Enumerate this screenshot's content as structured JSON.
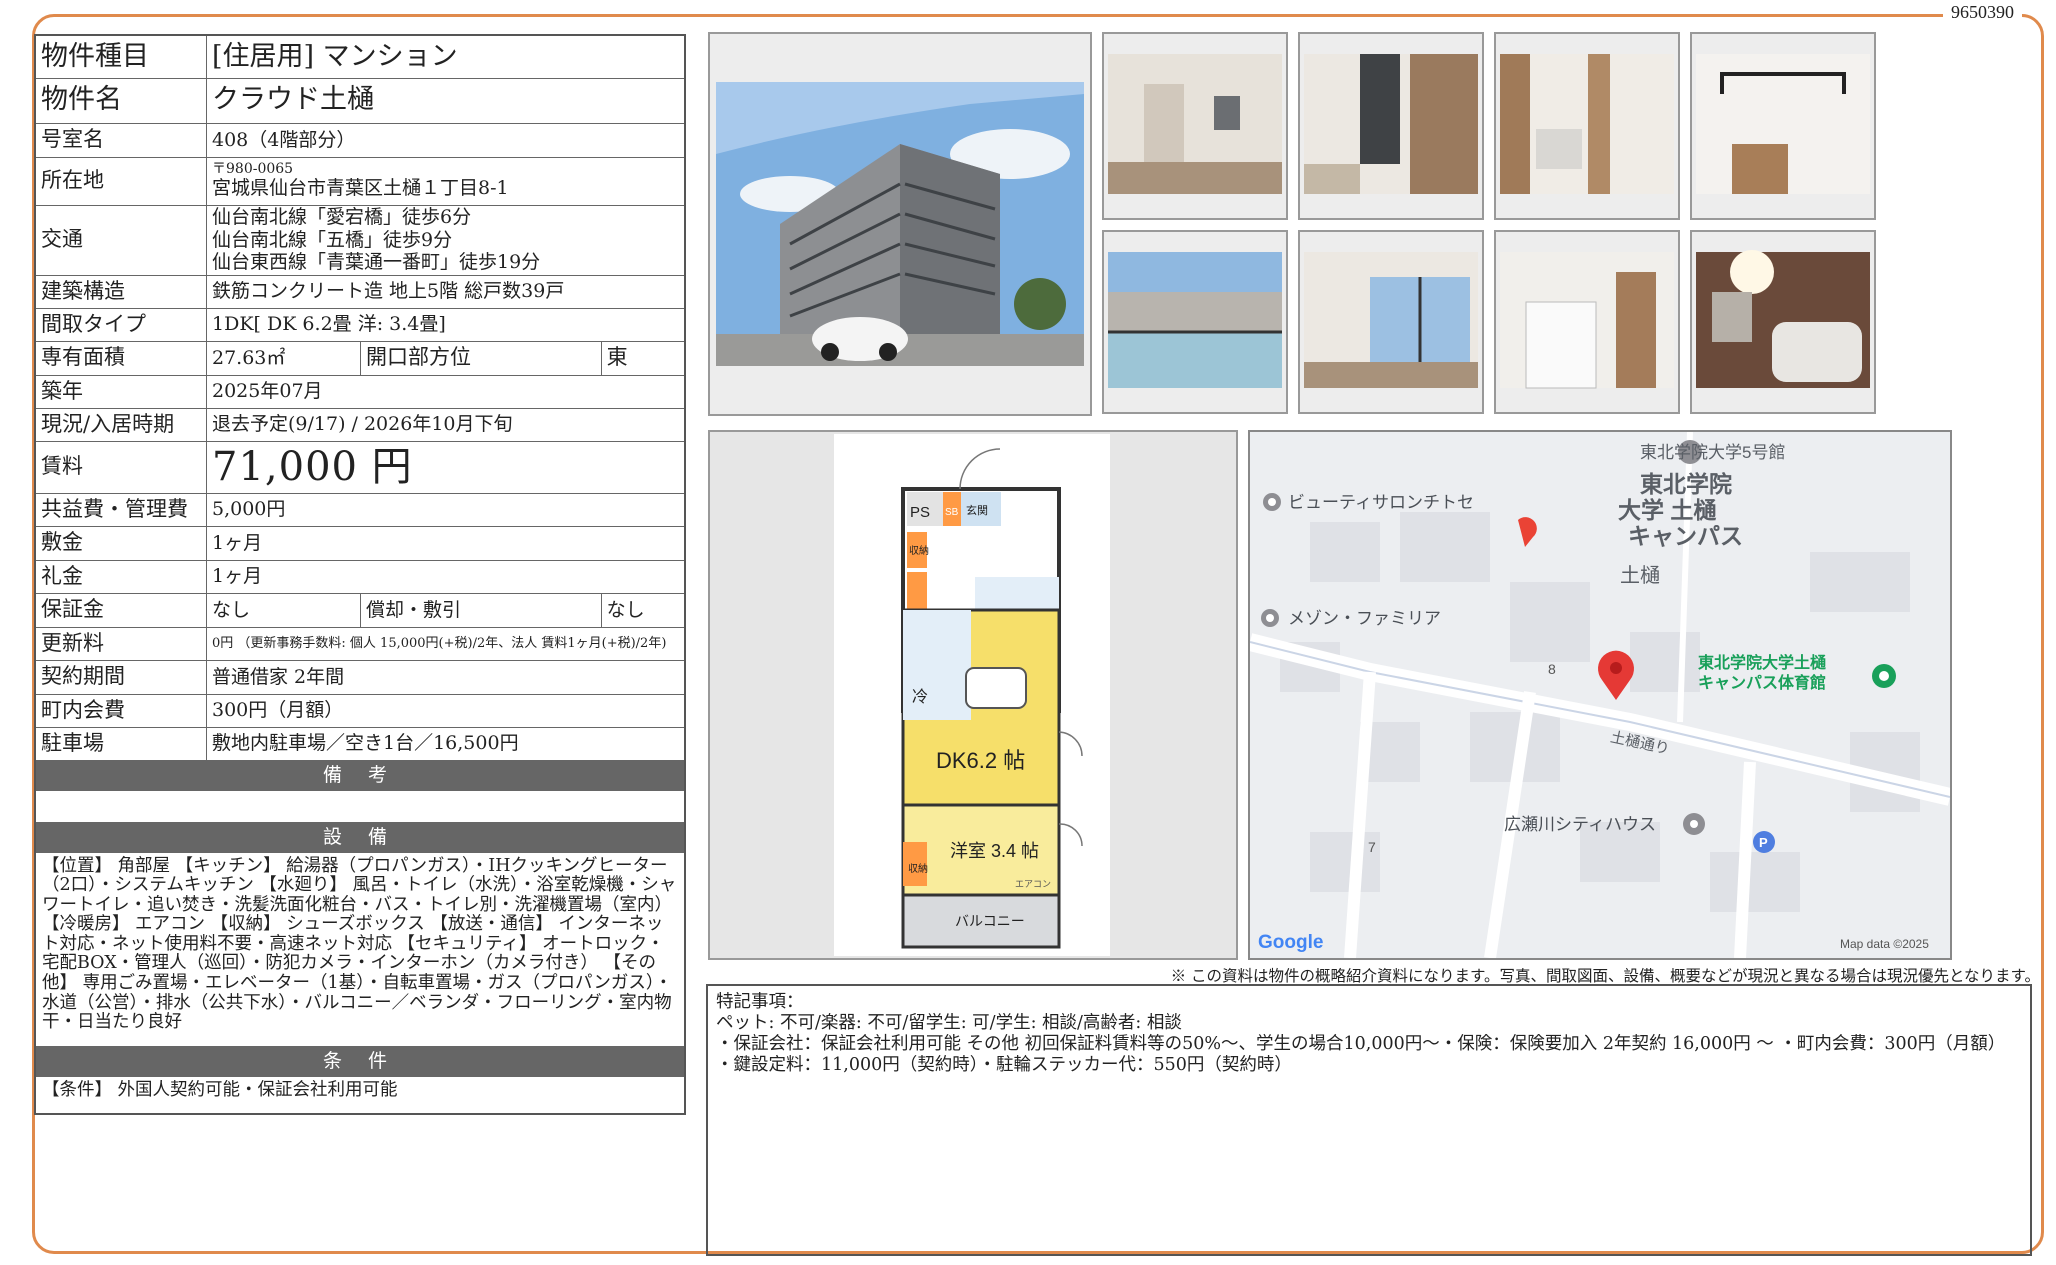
{
  "doc_id": "9650390",
  "property": {
    "type_label": "物件種目",
    "type_value": "[住居用] マンション",
    "name_label": "物件名",
    "name_value": "クラウド土樋",
    "room_label": "号室名",
    "room_value": "408（4階部分）",
    "address_label": "所在地",
    "address_zip": "〒980-0065",
    "address_value": "宮城県仙台市青葉区土樋１丁目8-1",
    "transit_label": "交通",
    "transit": [
      "仙台南北線「愛宕橋」徒歩6分",
      "仙台南北線「五橋」徒歩9分",
      "仙台東西線「青葉通一番町」徒歩19分"
    ],
    "structure_label": "建築構造",
    "structure_value": "鉄筋コンクリート造 地上5階 総戸数39戸",
    "layout_label": "間取タイプ",
    "layout_value": "1DK[ DK 6.2畳 洋: 3.4畳]",
    "area_label": "専有面積",
    "area_value": "27.63㎡",
    "direction_label": "開口部方位",
    "direction_value": "東",
    "built_label": "築年",
    "built_value": "2025年07月",
    "status_label": "現況/入居時期",
    "status_value": "退去予定(9/17) / 2026年10月下旬",
    "rent_label": "賃料",
    "rent_value": "71,000 円",
    "fee_label": "共益費・管理費",
    "fee_value": "5,000円",
    "deposit_label": "敷金",
    "deposit_value": "1ヶ月",
    "keymoney_label": "礼金",
    "keymoney_value": "1ヶ月",
    "guarantee_label": "保証金",
    "guarantee_value": "なし",
    "amort_label": "償却・敷引",
    "amort_value": "なし",
    "renewal_label": "更新料",
    "renewal_value": "0円 （更新事務手数料: 個人 15,000円(+税)/2年、法人 賃料1ヶ月(+税)/2年)",
    "contract_label": "契約期間",
    "contract_value": "普通借家 2年間",
    "community_label": "町内会費",
    "community_value": "300円（月額）",
    "parking_label": "駐車場",
    "parking_value": "敷地内駐車場／空き1台／16,500円"
  },
  "sections": {
    "remarks_title": "備 考",
    "remarks_body": "",
    "equipment_title": "設 備",
    "equipment_body": "【位置】 角部屋 【キッチン】 給湯器（プロパンガス）・IHクッキングヒーター（2口）・システムキッチン 【水廻り】 風呂・トイレ（水洗）・浴室乾燥機・シャワートイレ・追い焚き・洗髪洗面化粧台・バス・トイレ別・洗濯機置場（室内） 【冷暖房】 エアコン 【収納】 シューズボックス 【放送・通信】 インターネット対応・ネット使用料不要・高速ネット対応 【セキュリティ】 オートロック・宅配BOX・管理人（巡回）・防犯カメラ・インターホン（カメラ付き） 【その他】 専用ごみ置場・エレベーター（1基）・自転車置場・ガス（プロパンガス）・水道（公営）・排水（公共下水）・バルコニー／ベランダ・フローリング・室内物干・日当たり良好",
    "conditions_title": "条 件",
    "conditions_body": "【条件】 外国人契約可能・保証会社利用可能"
  },
  "floorplan": {
    "ps": "PS",
    "sb": "SB",
    "entrance": "玄関",
    "storage": "収納",
    "fridge": "冷",
    "dk": "DK6.2 帖",
    "western": "洋室 3.4 帖",
    "aircon": "エアコン",
    "balcony": "バルコニー"
  },
  "map": {
    "labels": {
      "univ_bldg": "東北学院大学5号館",
      "campus": "東北学院\n大学 土樋\nキャンパス",
      "tsuchitoi": "土樋",
      "salon": "ビューティサロンチトセ",
      "maison": "メゾン・ファミリア",
      "gym": "東北学院大学土樋\nキャンパス体育館",
      "street": "土樋通り",
      "hirose": "広瀬川シティハウス",
      "num8": "8",
      "num7": "7",
      "parking": "P"
    },
    "google": "Google",
    "copyright": "Map data ©2025"
  },
  "note": "※ この資料は物件の概略紹介資料になります。写真、間取図面、設備、概要などが現況と異なる場合は現況優先となります。",
  "special": {
    "title": "特記事項：",
    "lines": [
      "ペット: 不可/楽器: 不可/留学生: 可/学生: 相談/高齢者: 相談",
      "・保証会社：保証会社利用可能 その他 初回保証料賃料等の50%〜、学生の場合10,000円〜・保険：保険要加入 2年契約 16,000円 〜 ・町内会費：300円（月額）",
      "・鍵設定料：11,000円（契約時）・駐輪ステッカー代：550円（契約時）"
    ]
  }
}
